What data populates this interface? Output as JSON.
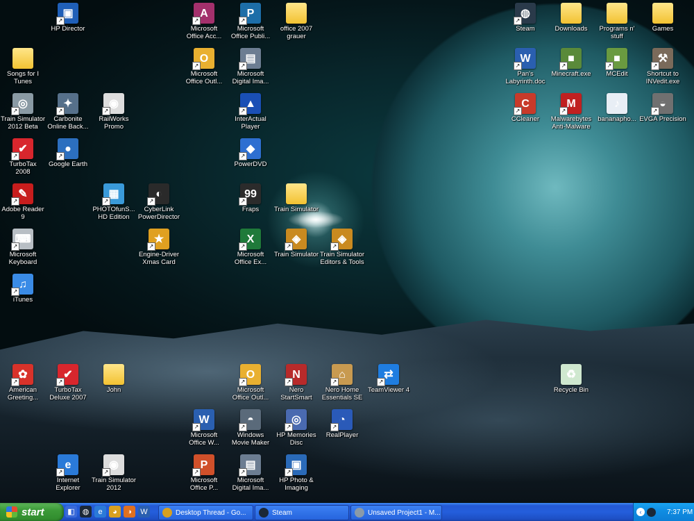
{
  "desktop_icons": [
    {
      "label": "HP Director",
      "icon": "hp-director-icon",
      "color": "#1f5fb8",
      "glyph": "▣"
    },
    {
      "label": "Songs for I\nTunes",
      "icon": "folder-icon",
      "color": "#f2c232",
      "glyph": ""
    },
    {
      "label": "Train Simulator\n2012 Beta",
      "icon": "train-simulator-beta-icon",
      "color": "#8a9aa4",
      "glyph": "◎"
    },
    {
      "label": "Carbonite\nOnline Back...",
      "icon": "carbonite-icon",
      "color": "#56708a",
      "glyph": "✦"
    },
    {
      "label": "RailWorks\nPromo",
      "icon": "railworks-icon",
      "color": "#dddddd",
      "glyph": "◉"
    },
    {
      "label": "TurboTax\n2008",
      "icon": "turbotax-icon",
      "color": "#d8262d",
      "glyph": "✔"
    },
    {
      "label": "Google Earth",
      "icon": "google-earth-icon",
      "color": "#2c6fbf",
      "glyph": "●"
    },
    {
      "label": "Adobe Reader\n9",
      "icon": "adobe-reader-icon",
      "color": "#c71d1d",
      "glyph": "✎"
    },
    {
      "label": "PHOTOfunS...\nHD Edition",
      "icon": "photofunstudio-icon",
      "color": "#3a9ad9",
      "glyph": "▦"
    },
    {
      "label": "CyberLink\nPowerDirector",
      "icon": "powerdirector-icon",
      "color": "#2a2a2a",
      "glyph": "◐"
    },
    {
      "label": "Microsoft\nKeyboard",
      "icon": "keyboard-icon",
      "color": "#b8bec4",
      "glyph": "⌨"
    },
    {
      "label": "Engine-Driver\nXmas Card",
      "icon": "engine-driver-icon",
      "color": "#e0a020",
      "glyph": "★"
    },
    {
      "label": "iTunes",
      "icon": "itunes-icon",
      "color": "#3a8be6",
      "glyph": "♫"
    },
    {
      "label": "Microsoft\nOffice Acc...",
      "icon": "access-icon",
      "color": "#a3306c",
      "glyph": "A"
    },
    {
      "label": "Microsoft\nOffice Publi...",
      "icon": "publisher-icon",
      "color": "#1d6ea8",
      "glyph": "P"
    },
    {
      "label": "office 2007\ngrauer",
      "icon": "folder-icon",
      "color": "#f2c232",
      "glyph": ""
    },
    {
      "label": "Microsoft\nOffice Outl...",
      "icon": "outlook-icon",
      "color": "#e9b030",
      "glyph": "O"
    },
    {
      "label": "Microsoft\nDigital Ima...",
      "icon": "digital-image-icon",
      "color": "#6c7d92",
      "glyph": "▤"
    },
    {
      "label": "InterActual\nPlayer",
      "icon": "interactual-icon",
      "color": "#1a4fb5",
      "glyph": "▲"
    },
    {
      "label": "PowerDVD",
      "icon": "powerdvd-icon",
      "color": "#2e6fd1",
      "glyph": "◆"
    },
    {
      "label": "Fraps",
      "icon": "fraps-icon",
      "color": "#2b2b2b",
      "glyph": "99"
    },
    {
      "label": "Train Simulator",
      "icon": "folder-icon",
      "color": "#f2c232",
      "glyph": ""
    },
    {
      "label": "Microsoft\nOffice Ex...",
      "icon": "excel-icon",
      "color": "#1f7a3a",
      "glyph": "X"
    },
    {
      "label": "Train Simulator",
      "icon": "train-simulator-icon",
      "color": "#c98a20",
      "glyph": "◈"
    },
    {
      "label": "Train Simulator\nEditors & Tools",
      "icon": "train-editor-icon",
      "color": "#c98a20",
      "glyph": "◈"
    },
    {
      "label": "Steam",
      "icon": "steam-icon",
      "color": "#2a3a4a",
      "glyph": "◍"
    },
    {
      "label": "Downloads",
      "icon": "folder-icon",
      "color": "#f2c232",
      "glyph": ""
    },
    {
      "label": "Programs n'\nstuff",
      "icon": "folder-icon",
      "color": "#f2c232",
      "glyph": ""
    },
    {
      "label": "Games",
      "icon": "folder-icon",
      "color": "#f2c232",
      "glyph": ""
    },
    {
      "label": "Pan's\nLabyrinth.doc",
      "icon": "word-document-icon",
      "color": "#2a5fb0",
      "glyph": "W"
    },
    {
      "label": "Minecraft.exe",
      "icon": "minecraft-icon",
      "color": "#5a8a3a",
      "glyph": "■"
    },
    {
      "label": "MCEdit",
      "icon": "mcedit-icon",
      "color": "#6a9a40",
      "glyph": "■"
    },
    {
      "label": "Shortcut to\nINVedit.exe",
      "icon": "invedit-icon",
      "color": "#7a6a5a",
      "glyph": "⚒"
    },
    {
      "label": "CCleaner",
      "icon": "ccleaner-icon",
      "color": "#c83a2a",
      "glyph": "C"
    },
    {
      "label": "Malwarebytes\nAnti-Malware",
      "icon": "malwarebytes-icon",
      "color": "#c02020",
      "glyph": "M"
    },
    {
      "label": "bananapho...",
      "icon": "mp3-file-icon",
      "color": "#e8eef5",
      "glyph": "♪"
    },
    {
      "label": "EVGA Precision",
      "icon": "evga-precision-icon",
      "color": "#707070",
      "glyph": "◒"
    },
    {
      "label": "American\nGreeting...",
      "icon": "american-greetings-icon",
      "color": "#d8322a",
      "glyph": "✿"
    },
    {
      "label": "TurboTax\nDeluxe 2007",
      "icon": "turbotax-deluxe-icon",
      "color": "#d8262d",
      "glyph": "✔"
    },
    {
      "label": "John",
      "icon": "folder-icon",
      "color": "#f2c232",
      "glyph": ""
    },
    {
      "label": "Microsoft\nOffice Outl...",
      "icon": "outlook-icon",
      "color": "#e9b030",
      "glyph": "O"
    },
    {
      "label": "Nero\nStartSmart",
      "icon": "nero-icon",
      "color": "#b82a2a",
      "glyph": "N"
    },
    {
      "label": "Nero Home\nEssentials SE",
      "icon": "nero-home-icon",
      "color": "#c89a50",
      "glyph": "⌂"
    },
    {
      "label": "TeamViewer 4",
      "icon": "teamviewer-icon",
      "color": "#1f7de0",
      "glyph": "⇄"
    },
    {
      "label": "Recycle Bin",
      "icon": "recycle-bin-icon",
      "color": "#cfe8cf",
      "glyph": "♻"
    },
    {
      "label": "Microsoft\nOffice W...",
      "icon": "word-icon",
      "color": "#2a5fb0",
      "glyph": "W"
    },
    {
      "label": "Windows\nMovie Maker",
      "icon": "movie-maker-icon",
      "color": "#5a6a7a",
      "glyph": "◓"
    },
    {
      "label": "HP Memories\nDisc",
      "icon": "hp-memories-icon",
      "color": "#4a6ab0",
      "glyph": "◎"
    },
    {
      "label": "RealPlayer",
      "icon": "realplayer-icon",
      "color": "#2a5ab8",
      "glyph": "◔"
    },
    {
      "label": "Internet\nExplorer",
      "icon": "internet-explorer-icon",
      "color": "#2a7ad8",
      "glyph": "e"
    },
    {
      "label": "Train Simulator\n2012",
      "icon": "train-simulator-2012-icon",
      "color": "#dddddd",
      "glyph": "◉"
    },
    {
      "label": "Microsoft\nOffice P...",
      "icon": "powerpoint-icon",
      "color": "#d0502a",
      "glyph": "P"
    },
    {
      "label": "Microsoft\nDigital Ima...",
      "icon": "digital-image-icon",
      "color": "#6c7d92",
      "glyph": "▤"
    },
    {
      "label": "HP Photo &\nImaging",
      "icon": "hp-photo-icon",
      "color": "#2a6ab8",
      "glyph": "▣"
    }
  ],
  "taskbar": {
    "start_label": "start",
    "quick_launch": [
      {
        "icon": "show-desktop-icon",
        "color": "#3a6ad8",
        "glyph": "◧"
      },
      {
        "icon": "steam-icon",
        "color": "#1b2838",
        "glyph": "◍"
      },
      {
        "icon": "internet-explorer-icon",
        "color": "#2a7ad8",
        "glyph": "e"
      },
      {
        "icon": "chrome-icon",
        "color": "#d8a020",
        "glyph": "◕"
      },
      {
        "icon": "firefox-icon",
        "color": "#e07020",
        "glyph": "◑"
      },
      {
        "icon": "word-icon",
        "color": "#2a5fb0",
        "glyph": "W"
      }
    ],
    "tasks": [
      {
        "label": "Desktop Thread - Go...",
        "icon": "chrome-icon",
        "color": "#d8a020"
      },
      {
        "label": "Steam",
        "icon": "steam-icon",
        "color": "#1b2838"
      },
      {
        "label": "Unsaved Project1 - M...",
        "icon": "movie-maker-icon",
        "color": "#8a9aa8"
      }
    ],
    "clock": "7:37 PM"
  }
}
